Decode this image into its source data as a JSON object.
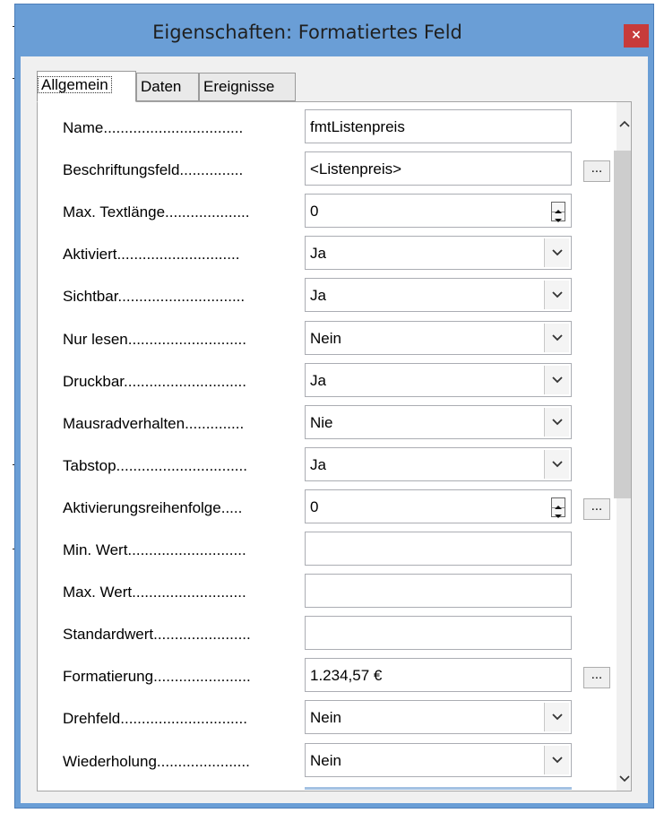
{
  "window": {
    "title": "Eigenschaften: Formatiertes Feld",
    "close_glyph": "×"
  },
  "tabs": [
    {
      "label": "Allgemein",
      "active": true
    },
    {
      "label": "Daten",
      "active": false
    },
    {
      "label": "Ereignisse",
      "active": false
    }
  ],
  "properties": [
    {
      "label": "Name.................................",
      "value": "fmtListenpreis",
      "control": "text"
    },
    {
      "label": "Beschriftungsfeld...............",
      "value": "<Listenpreis>",
      "control": "text",
      "dots_button": "..."
    },
    {
      "label": "Max. Textlänge....................",
      "value": "0",
      "control": "spin"
    },
    {
      "label": "Aktiviert.............................",
      "value": "Ja",
      "control": "dropdown"
    },
    {
      "label": "Sichtbar..............................",
      "value": "Ja",
      "control": "dropdown"
    },
    {
      "label": "Nur lesen............................",
      "value": "Nein",
      "control": "dropdown"
    },
    {
      "label": "Druckbar.............................",
      "value": "Ja",
      "control": "dropdown"
    },
    {
      "label": "Mausradverhalten..............",
      "value": "Nie",
      "control": "dropdown"
    },
    {
      "label": "Tabstop...............................",
      "value": "Ja",
      "control": "dropdown"
    },
    {
      "label": "Aktivierungsreihenfolge.....",
      "value": "0",
      "control": "spin",
      "dots_button": "..."
    },
    {
      "label": "Min. Wert............................",
      "value": "",
      "control": "text"
    },
    {
      "label": "Max. Wert...........................",
      "value": "",
      "control": "text"
    },
    {
      "label": "Standardwert.......................",
      "value": "",
      "control": "text"
    },
    {
      "label": "Formatierung.......................",
      "value": "1.234,57 €",
      "control": "text",
      "dots_button": "..."
    },
    {
      "label": "Drehfeld..............................",
      "value": "Nein",
      "control": "dropdown"
    },
    {
      "label": "Wiederholung......................",
      "value": "Nein",
      "control": "dropdown"
    }
  ],
  "icons": {
    "dropdown": "chevron-down-icon",
    "spin": "spin-arrows-icon",
    "scroll_up": "scroll-up-icon",
    "scroll_down": "scroll-down-icon"
  },
  "colors": {
    "titlebar": "#6a9ed6",
    "close": "#c73b3b",
    "panel_bg": "#ffffff",
    "client_bg": "#f0f0f0"
  }
}
